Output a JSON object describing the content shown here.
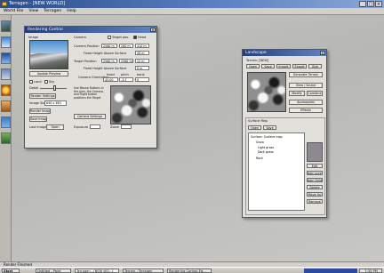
{
  "app": {
    "title": "Terragen - [NEW WORLD]"
  },
  "menu": [
    "World File",
    "View",
    "Terragen",
    "Help"
  ],
  "rendering_control": {
    "title": "Rendering Control",
    "image_section_label": "Image",
    "update_preview_label": "Update Preview",
    "land_label": "Land",
    "sky_label": "Sky",
    "detail_label": "Detail",
    "render_settings_label": "Render Settings",
    "image_size_label": "Image Size",
    "image_size_value": "640 x 480",
    "render_image_label": "Render Image",
    "save_image_label": "Save Image",
    "last_image_label": "Last Image",
    "open_label": "Open",
    "camera_section_label": "Camera",
    "target_label": "Target pos.",
    "head_label": "Head",
    "camera_position_label": "Camera Position",
    "camera_position_values": [
      "2560 m",
      "280 m",
      "410 m"
    ],
    "fixed_height_camera_label": "Fixed Height Above Surface",
    "fixed_height_camera_value": "30 m",
    "target_position_label": "Target Position",
    "target_position_values": [
      "2560 m",
      "2560 m",
      "12 m"
    ],
    "fixed_height_target_label": "Fixed Height Above Surface",
    "fixed_height_target_value": "0 m",
    "camera_orientation_label": "Camera Orientation",
    "orientation_headers": [
      "head",
      "pitch",
      "bank"
    ],
    "orientation_values": [
      "45.00",
      "-3.5",
      "0"
    ],
    "hint_1": "Use Mouse Buttons in the plan, the Camera, and Right button positions the Target",
    "camera_settings_label": "Camera Settings",
    "zoom_label": "Zoom",
    "exposure_label": "Exposure"
  },
  "landscape": {
    "title": "Landscape",
    "terrain_label": "Terrain: [NEW]",
    "buttons_row1": [
      "Open",
      "Save",
      "Import",
      "Export",
      "Size"
    ],
    "generate_terrain_label": "Generate Terrain",
    "view_sculpt_label": "View / Sculpt",
    "modify_label": "Modify",
    "combine_label": "Combine",
    "accessories_label": "Accessories",
    "effects_label": "Effects",
    "surface_map_label": "Surface Map",
    "sm_buttons": [
      "Open",
      "Save"
    ],
    "tree_nodes": [
      "Surface: Surface map",
      "Snow",
      "Light grass",
      "Dark grass",
      "Rock"
    ],
    "side_buttons": [
      "Edit",
      "Add Layer",
      "Add Child",
      "Delete",
      "Move Up",
      "Remove"
    ]
  },
  "status": {
    "text": "Render Finished"
  },
  "taskbar": {
    "start_label": "Start",
    "tasks": [
      "Untitled - Paint",
      "Terragen - [NEW WO...]",
      "Terrain - Terragen",
      "Rendering Control Ed..."
    ],
    "clock": "7:33 PM"
  }
}
